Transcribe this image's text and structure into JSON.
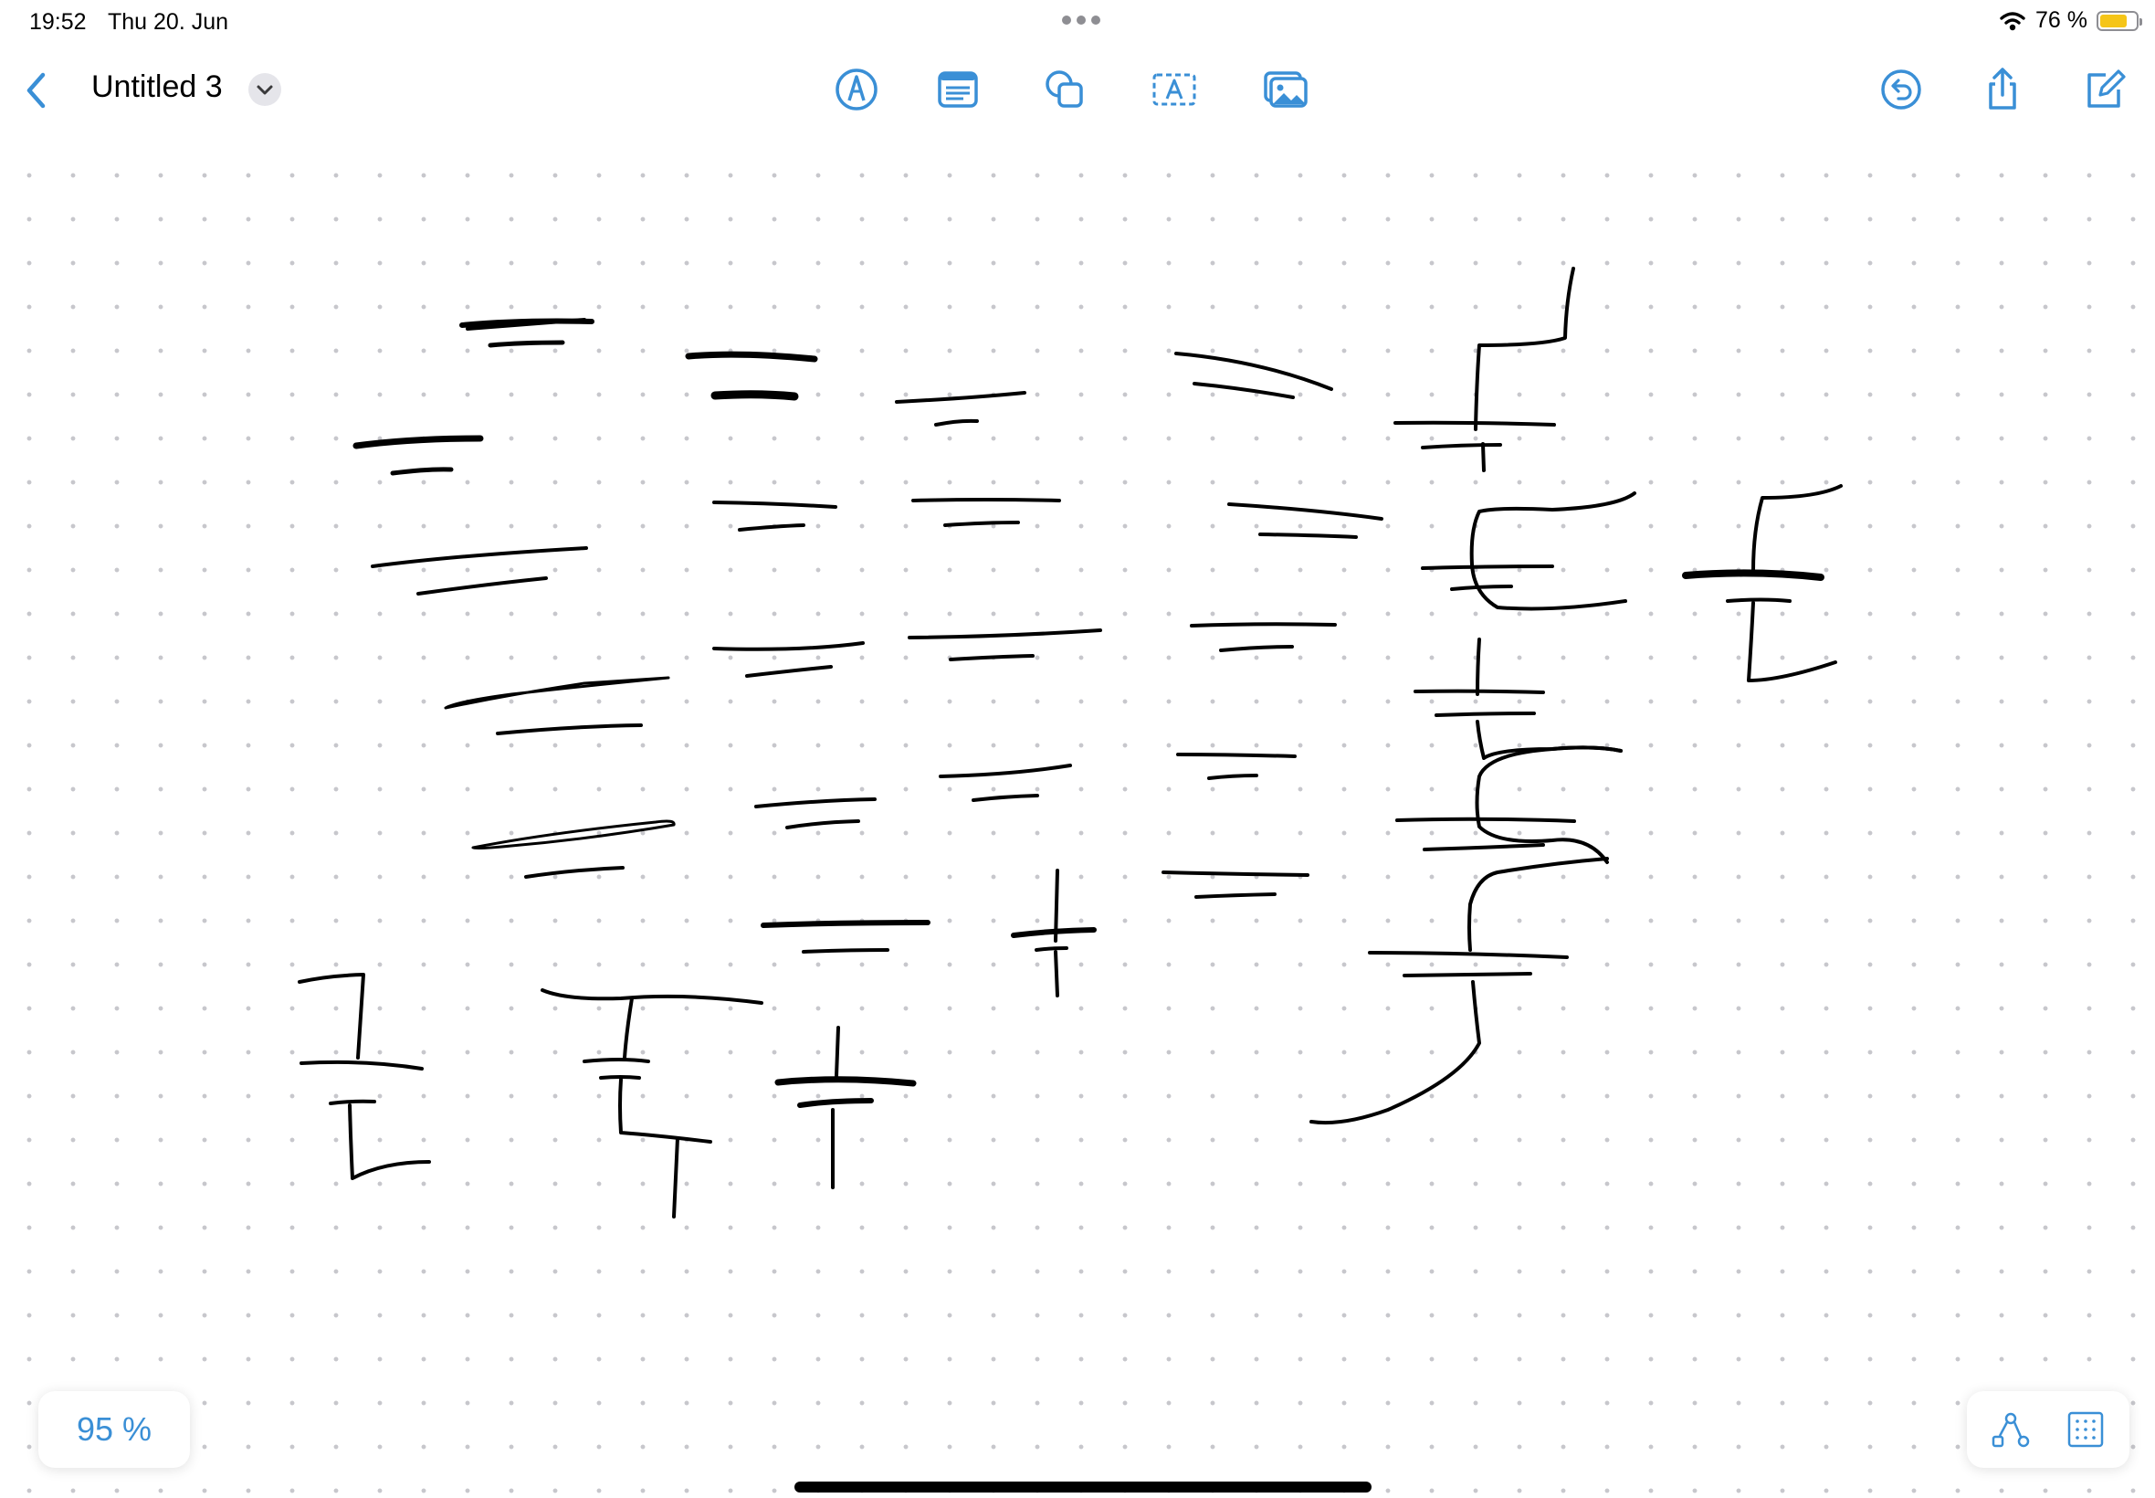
{
  "status_bar": {
    "time": "19:52",
    "date": "Thu 20. Jun",
    "battery_text": "76 %",
    "battery_level": 0.76,
    "icons": [
      "multitasking-dots-icon",
      "wifi-icon",
      "battery-icon"
    ]
  },
  "toolbar": {
    "title": "Untitled 3",
    "left_icons": [
      "back-chevron-icon",
      "title-menu-chevron-icon"
    ],
    "center_icons": [
      "pen-tool-icon",
      "sticky-note-icon",
      "shapes-icon",
      "text-box-icon",
      "media-icon"
    ],
    "right_icons": [
      "undo-icon",
      "share-icon",
      "compose-icon"
    ]
  },
  "canvas": {
    "background": "dot-grid",
    "ink_color": "#000000"
  },
  "zoom": {
    "label": "95 %"
  },
  "bottom_tools": {
    "icons": [
      "diagram-icon",
      "grid-icon"
    ]
  },
  "colors": {
    "accent": "#3a8fd6",
    "dots": "#c7c7cc",
    "battery_fill": "#f5c518"
  }
}
